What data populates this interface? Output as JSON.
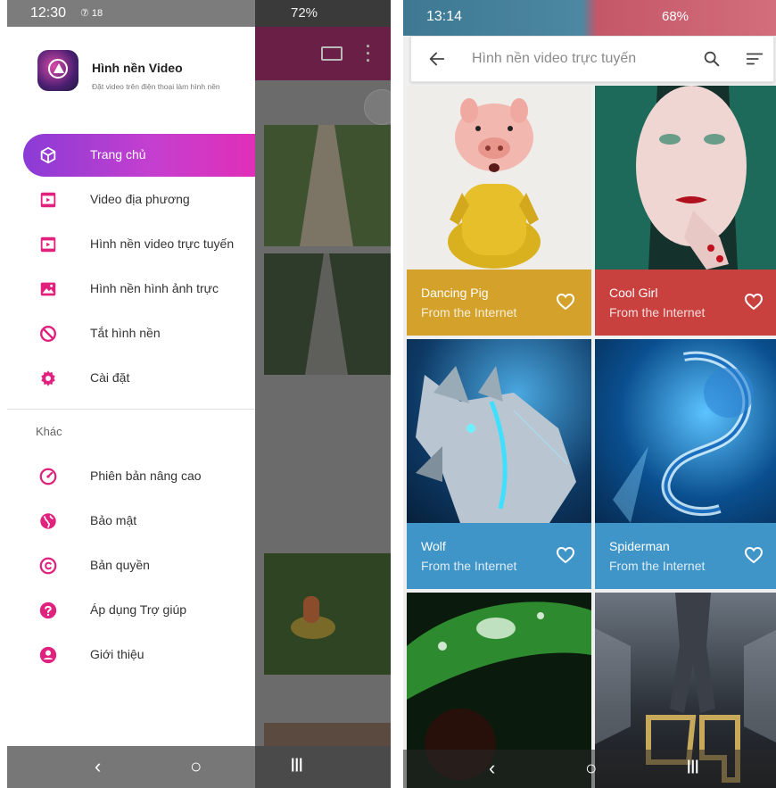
{
  "left_phone": {
    "status_bar": {
      "time": "12:30",
      "indicators": "⑦ 18",
      "right": "72%"
    },
    "drawer": {
      "app_name": "Hình nền Video",
      "app_subtitle": "Đặt video trên điện thoại làm hình nền",
      "items": [
        {
          "label": "Trang chủ",
          "icon": "cube-icon",
          "active": true
        },
        {
          "label": "Video địa phương",
          "icon": "video-file-icon"
        },
        {
          "label": "Hình nền video trực tuyến",
          "icon": "video-file-icon"
        },
        {
          "label": "Hình nền hình ảnh trực",
          "icon": "image-icon"
        },
        {
          "label": "Tắt hình nền",
          "icon": "block-icon"
        },
        {
          "label": "Cài đặt",
          "icon": "gear-icon"
        }
      ],
      "section_label": "Khác",
      "other_items": [
        {
          "label": "Phiên bản nâng cao",
          "icon": "speedometer-icon"
        },
        {
          "label": "Bảo mật",
          "icon": "globe-icon"
        },
        {
          "label": "Bản quyền",
          "icon": "copyright-icon"
        },
        {
          "label": "Áp dụng Trợ giúp",
          "icon": "help-icon"
        },
        {
          "label": "Giới thiệu",
          "icon": "person-icon"
        }
      ]
    },
    "nav": {
      "back": "‹",
      "home": "○",
      "recents": "|||"
    }
  },
  "right_phone": {
    "status_bar": {
      "time": "13:14",
      "right": "68%"
    },
    "search": {
      "placeholder": "Hình nền video trực tuyến"
    },
    "cards": [
      {
        "title": "Dancing Pig",
        "subtitle": "From the Internet",
        "color": "#d4a12a"
      },
      {
        "title": "Cool Girl",
        "subtitle": "From the Internet",
        "color": "#c9413f"
      },
      {
        "title": "Wolf",
        "subtitle": "From the Internet",
        "color": "#3f95c8"
      },
      {
        "title": "Spiderman",
        "subtitle": "From the Internet",
        "color": "#3f95c8"
      }
    ],
    "nav": {
      "back": "‹",
      "home": "○",
      "recents": "|||"
    }
  },
  "colors": {
    "accent": "#e02fb8",
    "accent_start": "#8b3bd6",
    "icon_pink": "#e0217e"
  }
}
